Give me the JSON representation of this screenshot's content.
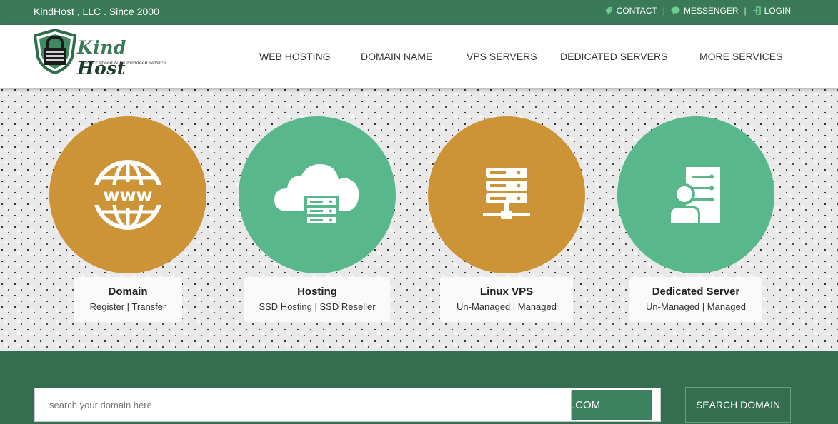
{
  "topbar": {
    "company": "KindHost , LLC . Since 2000",
    "links": [
      {
        "label": "CONTACT",
        "icon": "tag-icon"
      },
      {
        "label": "MESSENGER",
        "icon": "chat-bubble-icon"
      },
      {
        "label": "LOGIN",
        "icon": "login-arrow-icon"
      }
    ]
  },
  "logo": {
    "name_part1": "Kind",
    "name_part2": "Host",
    "tagline": "Perfect speed & Guaranteed service"
  },
  "nav": {
    "items": [
      "WEB HOSTING",
      "DOMAIN NAME",
      "VPS SERVERS",
      "DEDICATED SERVERS",
      "MORE SERVICES"
    ]
  },
  "services": [
    {
      "title": "Domain",
      "sub_a": "Register",
      "sub_b": "Transfer",
      "color": "#cc9437",
      "icon": "www-globe-icon"
    },
    {
      "title": "Hosting",
      "sub_a": "SSD Hosting",
      "sub_b": "SSD Reseller",
      "color": "#58b88c",
      "icon": "cloud-server-icon"
    },
    {
      "title": "Linux VPS",
      "sub_a": "Un-Managed",
      "sub_b": "Managed",
      "color": "#cc9437",
      "icon": "server-rack-icon"
    },
    {
      "title": "Dedicated Server",
      "sub_a": "Un-Managed",
      "sub_b": "Managed",
      "color": "#58b88c",
      "icon": "user-server-icon"
    }
  ],
  "search": {
    "placeholder": "search your domain here",
    "tld": ".COM",
    "button_label": "SEARCH DOMAIN"
  },
  "colors": {
    "brand_green": "#3a7a58",
    "band_green": "#346e50",
    "gold": "#cc9437",
    "mint": "#58b88c"
  }
}
